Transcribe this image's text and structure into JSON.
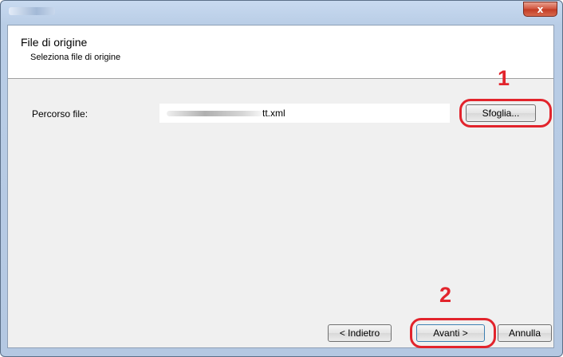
{
  "window": {
    "close_label": "x"
  },
  "header": {
    "title": "File di origine",
    "subtitle": "Seleziona file di origine"
  },
  "form": {
    "path_label": "Percorso file:",
    "path_value": "tt.xml",
    "browse_label": "Sfoglia..."
  },
  "footer": {
    "back_label": "< Indietro",
    "next_label": "Avanti >",
    "cancel_label": "Annulla"
  },
  "annotations": {
    "step1": "1",
    "step2": "2",
    "highlight_color": "#e2242c"
  }
}
